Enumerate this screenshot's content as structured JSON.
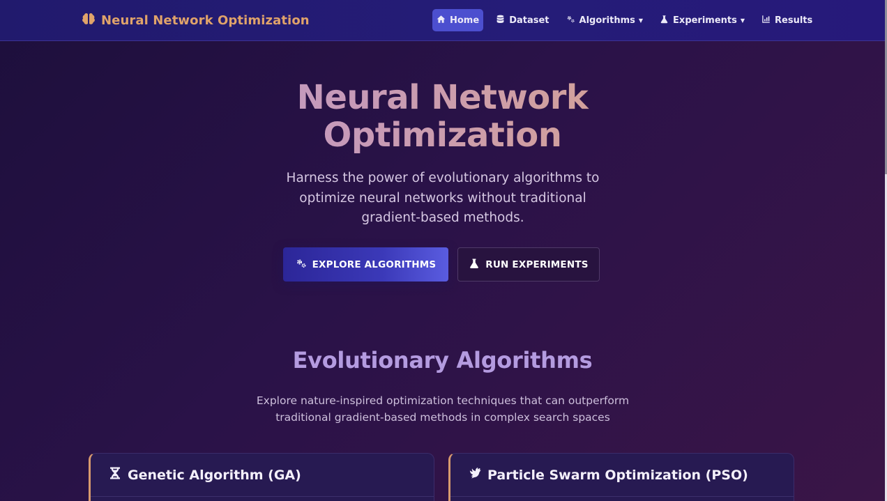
{
  "navbar": {
    "brand_title": "Neural Network Optimization",
    "brand_icon": "brain-icon",
    "items": [
      {
        "label": "Home",
        "icon": "home-icon",
        "active": true,
        "dropdown": false
      },
      {
        "label": "Dataset",
        "icon": "database-icon",
        "active": false,
        "dropdown": false
      },
      {
        "label": "Algorithms",
        "icon": "gears-icon",
        "active": false,
        "dropdown": true
      },
      {
        "label": "Experiments",
        "icon": "flask-icon",
        "active": false,
        "dropdown": true
      },
      {
        "label": "Results",
        "icon": "chart-icon",
        "active": false,
        "dropdown": false
      }
    ]
  },
  "hero": {
    "title_line1": "Neural Network",
    "title_line2": "Optimization",
    "subtitle": "Harness the power of evolutionary algorithms to optimize neural networks without traditional gradient-based methods.",
    "primary_button": "EXPLORE ALGORITHMS",
    "secondary_button": "RUN EXPERIMENTS"
  },
  "section": {
    "title": "Evolutionary Algorithms",
    "subtitle": "Explore nature-inspired optimization techniques that can outperform traditional gradient-based methods in complex search spaces"
  },
  "cards": [
    {
      "title": "Genetic Algorithm (GA)",
      "icon": "dna-icon"
    },
    {
      "title": "Particle Swarm Optimization (PSO)",
      "icon": "dove-icon"
    }
  ],
  "colors": {
    "accent_orange": "#e0a36a",
    "nav_active": "#4c4fcf",
    "section_title": "#b49be0"
  }
}
